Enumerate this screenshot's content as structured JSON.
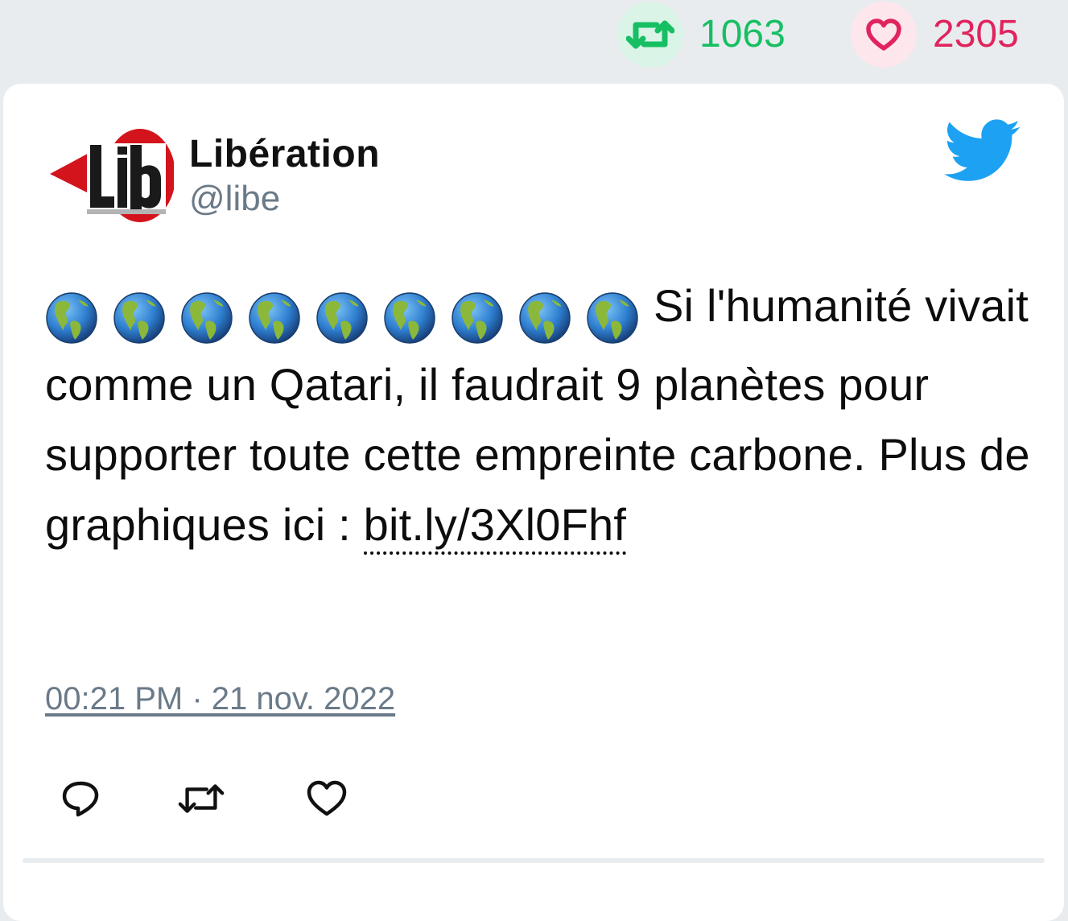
{
  "stats": {
    "retweets": "1063",
    "likes": "2305"
  },
  "author": {
    "name": "Libération",
    "handle": "@libe"
  },
  "tweet": {
    "globe_count": 9,
    "text": "Si l'humanité vivait comme un Qatari, il faudrait 9 planètes pour supporter toute cette empreinte carbone. Plus de graphiques ici : ",
    "link": "bit.ly/3Xl0Fhf",
    "timestamp": "00:21 PM · 21 nov. 2022"
  },
  "icons": {
    "retweet": "retweet-icon",
    "like": "heart-icon",
    "reply": "reply-icon",
    "brand": "twitter-bird-icon",
    "globe": "globe-americas-icon"
  },
  "colors": {
    "retweet": "#17bf63",
    "like": "#e0245e",
    "twitter": "#1da1f2",
    "muted": "#6a7a88"
  }
}
